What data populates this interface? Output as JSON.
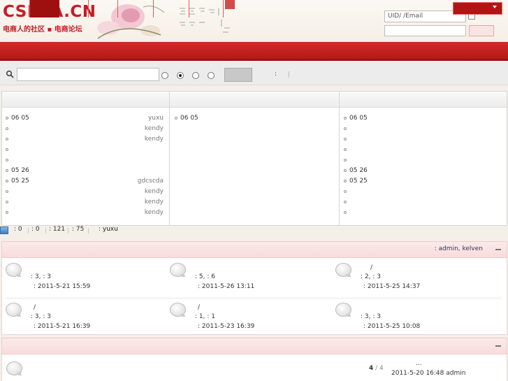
{
  "brand": {
    "logo": "CSECA.CN",
    "slogan": "电商人的社区 ▪ 电商论坛"
  },
  "login": {
    "uid_placeholder": "UID/  /Email"
  },
  "search": {
    "colon": ":"
  },
  "columns": [
    {
      "rows": [
        {
          "text": "06 05",
          "who": "yuxu"
        },
        {
          "text": "",
          "who": "kendy"
        },
        {
          "text": "",
          "who": "kendy"
        },
        {
          "text": "",
          "who": ""
        },
        {
          "text": "",
          "who": ""
        },
        {
          "text": "05 26",
          "who": ""
        },
        {
          "text": "05 25",
          "who": "gdcscda"
        },
        {
          "text": "",
          "who": "kendy"
        },
        {
          "text": "",
          "who": "kendy"
        },
        {
          "text": "",
          "who": "kendy"
        }
      ]
    },
    {
      "rows": [
        {
          "text": "06 05",
          "who": ""
        }
      ]
    },
    {
      "rows": [
        {
          "text": "06 05",
          "who": ""
        },
        {
          "text": "",
          "who": ""
        },
        {
          "text": "",
          "who": ""
        },
        {
          "text": "",
          "who": ""
        },
        {
          "text": "",
          "who": ""
        },
        {
          "text": "05 26",
          "who": ""
        },
        {
          "text": "05 25",
          "who": ""
        },
        {
          "text": "",
          "who": ""
        },
        {
          "text": "",
          "who": ""
        },
        {
          "text": "",
          "who": ""
        }
      ]
    }
  ],
  "stats": {
    "s1": ": 0",
    "s2": ": 0",
    "s3": ": 121",
    "s4": ": 75",
    "newest": ": yuxu"
  },
  "group1": {
    "moderators_prefix": ": ",
    "moderators": "admin, kelven",
    "forums": [
      {
        "title": "",
        "line2": ": 3,   : 3",
        "line3": ": 2011-5-21 15:59"
      },
      {
        "title": "",
        "line2": ": 5,   : 6",
        "line3": ": 2011-5-26 13:11"
      },
      {
        "title": "/",
        "line2": ": 2,   : 3",
        "line3": ": 2011-5-25 14:37"
      },
      {
        "title": "/",
        "line2": ": 3,   : 3",
        "line3": ": 2011-5-21 16:39"
      },
      {
        "title": "/",
        "line2": ": 1,   : 1",
        "line3": ": 2011-5-23 16:39"
      },
      {
        "title": "",
        "line2": ": 3,   : 3",
        "line3": ": 2011-5-25 10:08"
      }
    ]
  },
  "group2": {
    "count": "4",
    "count_sep": " / ",
    "total": "4",
    "last_title": "...",
    "last_post": "2011-5-20 16:48 admin"
  },
  "colors": {
    "brand_red": "#c81b26",
    "nav_red": "#c42222"
  }
}
